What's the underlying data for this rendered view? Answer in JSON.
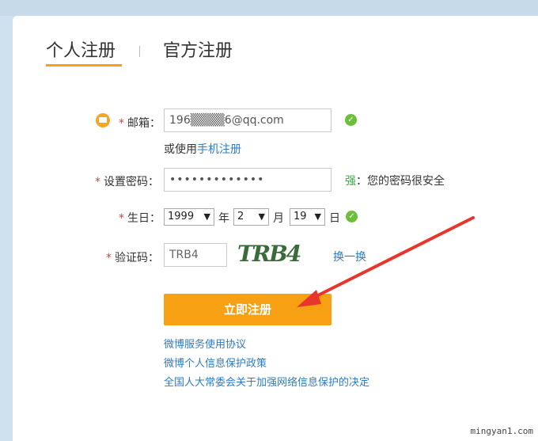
{
  "tabs": {
    "personal": "个人注册",
    "official": "官方注册"
  },
  "email": {
    "label": "邮箱：",
    "value": "196▒▒▒▒6@qq.com",
    "alt_prefix": "或使用",
    "alt_link": "手机注册"
  },
  "password": {
    "label": "设置密码：",
    "value": "•••••••••••••",
    "strength_word": "强",
    "strength_msg": "：您的密码很安全"
  },
  "birthday": {
    "label": "生日：",
    "year": "1999",
    "year_unit": "年",
    "month": "2",
    "month_unit": "月",
    "day": "19",
    "day_unit": "日"
  },
  "captcha": {
    "label": "验证码：",
    "value": "TRB4",
    "image_text": "TRB4",
    "refresh": "换一换"
  },
  "submit_label": "立即注册",
  "links": [
    "微博服务使用协议",
    "微博个人信息保护政策",
    "全国人大常委会关于加强网络信息保护的决定"
  ],
  "watermark": "mingyan1.com",
  "colors": {
    "accent": "#f7a014",
    "link": "#2c7bc4",
    "required": "#e4393c",
    "ok": "#6bbf3a",
    "arrow": "#e8352d"
  }
}
